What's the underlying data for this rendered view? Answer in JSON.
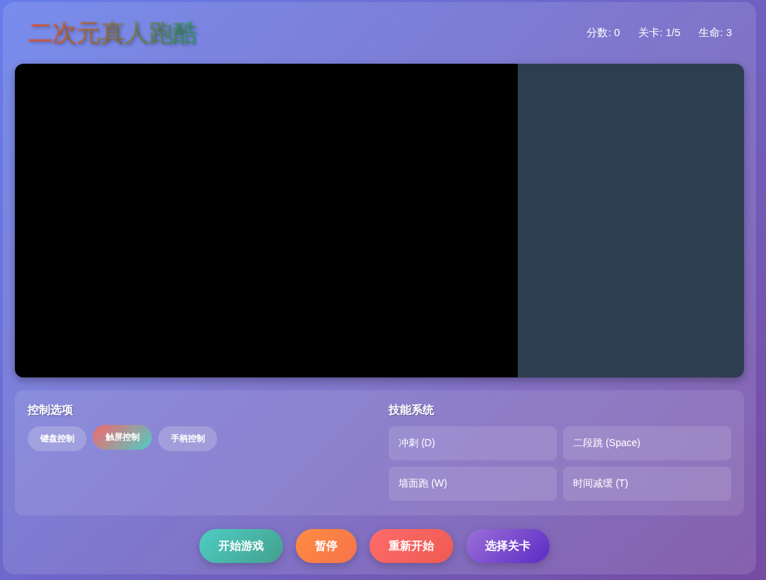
{
  "header": {
    "title": "二次元真人跑酷",
    "stats": [
      "分数: 0",
      "关卡: 1/5",
      "生命: 3"
    ]
  },
  "controls": {
    "title": "控制选项",
    "options": [
      {
        "label": "键盘控制",
        "selected": false
      },
      {
        "label": "触屏控制",
        "selected": true
      },
      {
        "label": "手柄控制",
        "selected": false
      }
    ]
  },
  "skills": {
    "title": "技能系统",
    "items": [
      "冲刺 (D)",
      "二段跳 (Space)",
      "墙面跑 (W)",
      "时间减缓 (T)"
    ]
  },
  "actions": [
    {
      "label": "开始游戏",
      "kind": "start"
    },
    {
      "label": "暂停",
      "kind": "pause"
    },
    {
      "label": "重新开始",
      "kind": "restart"
    },
    {
      "label": "选择关卡",
      "kind": "select"
    }
  ]
}
